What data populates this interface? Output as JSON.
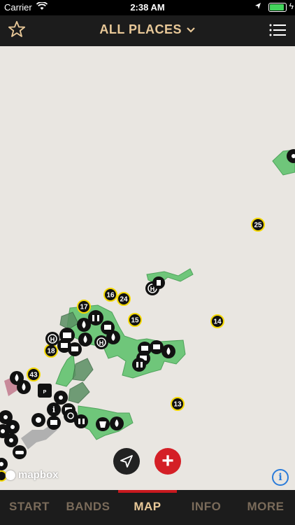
{
  "status_bar": {
    "carrier": "Carrier",
    "time": "2:38 AM"
  },
  "header": {
    "title": "ALL PLACES",
    "favorites_icon": "star-outline-icon",
    "menu_icon": "list-menu-icon",
    "title_icon": "chevron-down-icon"
  },
  "map": {
    "attribution": "mapbox",
    "markers": [
      "25",
      "16",
      "24",
      "17",
      "15",
      "14",
      "18",
      "43",
      "13"
    ]
  },
  "controls": {
    "locate_icon": "navigation-arrow-icon",
    "add_label": "+"
  },
  "tabs": [
    {
      "label": "START",
      "active": false
    },
    {
      "label": "BANDS",
      "active": false
    },
    {
      "label": "MAP",
      "active": true
    },
    {
      "label": "INFO",
      "active": false
    },
    {
      "label": "MORE",
      "active": false
    }
  ],
  "colors": {
    "accent": "#e8c898",
    "tab_active_indicator": "#c8181e",
    "marker_ring": "#f4d800",
    "map_area": "#6fc67a",
    "add_button": "#d41f26"
  }
}
